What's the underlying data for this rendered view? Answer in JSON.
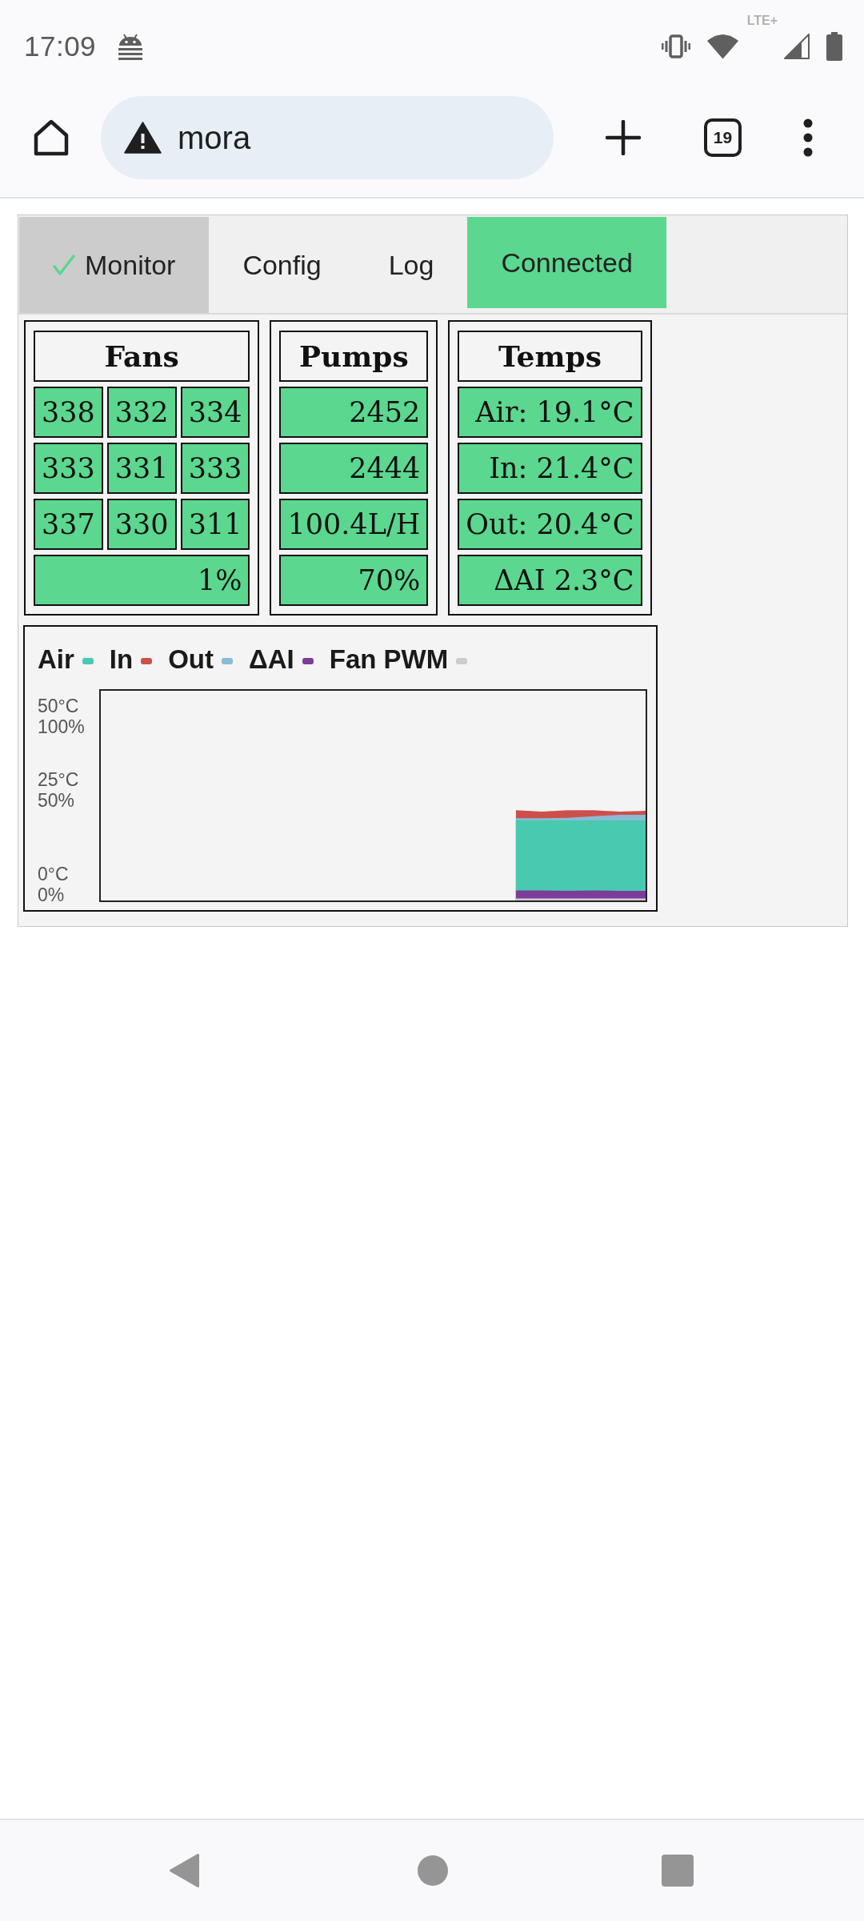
{
  "status_bar": {
    "time": "17:09",
    "network_type": "LTE+"
  },
  "browser": {
    "url": "mora",
    "tab_count": "19"
  },
  "tabs": [
    {
      "label": "Monitor",
      "selected": true
    },
    {
      "label": "Config",
      "selected": false
    },
    {
      "label": "Log",
      "selected": false
    }
  ],
  "connection": {
    "label": "Connected",
    "connected": true
  },
  "panels": [
    {
      "title": "Fans",
      "rows": [
        [
          "338",
          "332",
          "334"
        ],
        [
          "333",
          "331",
          "333"
        ],
        [
          "337",
          "330",
          "311"
        ]
      ],
      "footer": "1%"
    },
    {
      "title": "Pumps",
      "rows": [
        [
          "2452"
        ],
        [
          "2444"
        ],
        [
          "100.4L/H"
        ]
      ],
      "footer": "70%"
    },
    {
      "title": "Temps",
      "rows": [
        [
          "Air: 19.1°C"
        ],
        [
          "In: 21.4°C"
        ],
        [
          "Out: 20.4°C"
        ],
        [
          "ΔAI 2.3°C"
        ]
      ]
    }
  ],
  "chart": {
    "legend": [
      {
        "name": "Air",
        "color": "#48c9b0"
      },
      {
        "name": "In",
        "color": "#cd4f4b"
      },
      {
        "name": "Out",
        "color": "#89bcd3"
      },
      {
        "name": "ΔAI",
        "color": "#7d3c98"
      },
      {
        "name": "Fan PWM",
        "color": "#cccccc"
      }
    ],
    "axis_labels": [
      "50°C",
      "100%",
      "25°C",
      "50%",
      "0°C",
      "0%"
    ]
  }
}
